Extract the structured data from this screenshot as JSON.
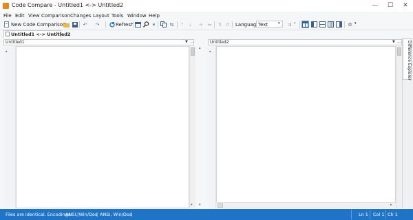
{
  "window": {
    "title": "Code Compare - Untitled1 <-> Untitled2",
    "minimize": "—",
    "maximize": "☐",
    "close": "✕"
  },
  "menu": [
    "File",
    "Edit",
    "View",
    "Comparison",
    "Changes",
    "Layout",
    "Tools",
    "Window",
    "Help"
  ],
  "toolbar": {
    "new_comparison_label": "New Code Comparison",
    "refresh_label": "Refresh",
    "language_label": "Language",
    "language_value": "Text",
    "icons": [
      "new-comparison-icon",
      "folder-icon",
      "save-icon",
      "undo-icon",
      "redo-icon",
      "refresh-icon",
      "layout-icon",
      "search-icon",
      "merge-icon",
      "swap-icon",
      "prev-diff-icon",
      "next-diff-icon",
      "first-change-icon",
      "last-change-icon",
      "copy-left-icon",
      "copy-right-icon",
      "view-mode-icons",
      "settings-icon"
    ]
  },
  "tab": {
    "label": "Untitled1 <-> Untitled2",
    "close": "×"
  },
  "left_panel": {
    "file_label": "Untitled1"
  },
  "right_panel": {
    "file_label": "Untitled2"
  },
  "difference_explorer": {
    "label": "Difference Explorer"
  },
  "status": {
    "message": "Files are identical. Encodings:",
    "left_encoding": "ANSI, Win/Dos",
    "right_encoding": "ANSI, Win/Dos",
    "line": "Ln 1",
    "col": "Col 1",
    "ch": "Ch 1"
  },
  "colors": {
    "statusbar": "#1f74c8",
    "accent": "#e8871e"
  }
}
